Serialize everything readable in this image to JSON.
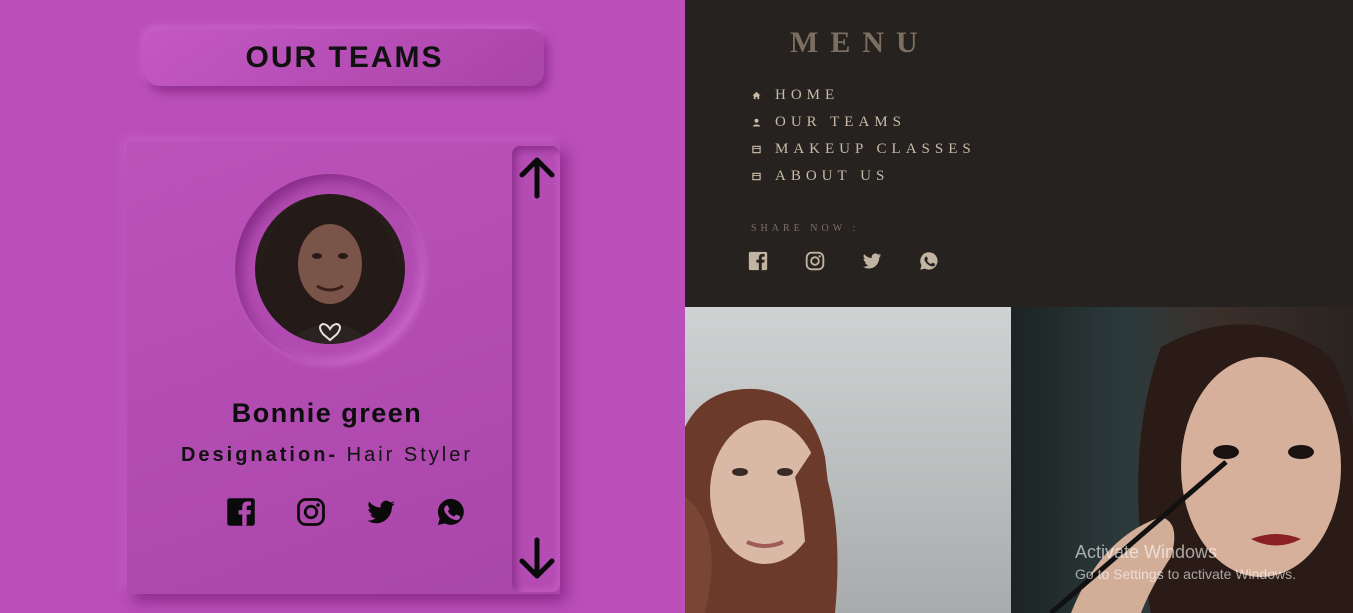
{
  "teams": {
    "heading": "OUR TEAMS",
    "member": {
      "name": "Bonnie green",
      "designation_prefix": "Designation-",
      "designation_value": "Hair Styler"
    },
    "social_icons": [
      "facebook-icon",
      "instagram-icon",
      "twitter-icon",
      "whatsapp-icon"
    ],
    "scroll": [
      "arrow-up-icon",
      "arrow-down-icon"
    ]
  },
  "menu": {
    "title": "MENU",
    "items": [
      {
        "label": "HOME",
        "icon": "home-icon"
      },
      {
        "label": "OUR TEAMS",
        "icon": "person-icon"
      },
      {
        "label": "MAKEUP CLASSES",
        "icon": "book-icon"
      },
      {
        "label": "ABOUT US",
        "icon": "book-icon"
      }
    ],
    "share_label": "SHARE NOW :",
    "social_icons": [
      "facebook-icon",
      "instagram-icon",
      "twitter-icon",
      "whatsapp-icon"
    ]
  },
  "watermark": {
    "line1": "Activate Windows",
    "line2": "Go to Settings to activate Windows."
  },
  "colors": {
    "left_bg": "#ba4fba",
    "menu_bg": "#25221f",
    "menu_title": "#7c6f62",
    "menu_text": "#c9bba8",
    "social_menu_icon": "#c2b4a2"
  }
}
